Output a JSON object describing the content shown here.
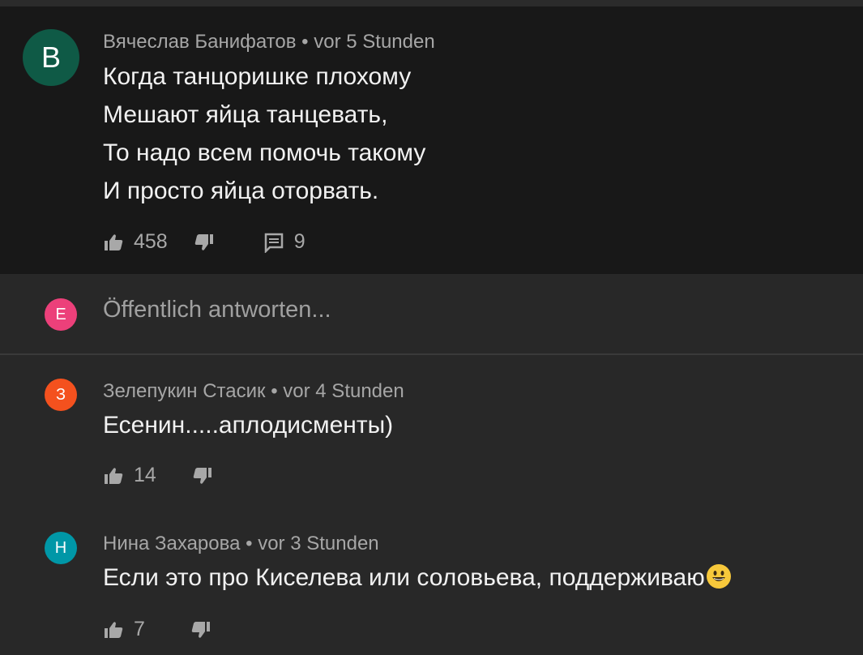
{
  "comments": [
    {
      "avatar_letter": "B",
      "avatar_color": "#0f5a46",
      "author": "Вячеслав Банифатов",
      "time": "vor 5 Stunden",
      "lines": [
        "Когда танцоришке плохому",
        "Мешают яйца танцевать,",
        "То надо всем помочь такому",
        "И просто яйца оторвать."
      ],
      "likes": "458",
      "replies": "9"
    },
    {
      "avatar_letter": "З",
      "avatar_color": "#f4511e",
      "author": "Зелепукин Стасик",
      "time": "vor 4 Stunden",
      "lines": [
        "Есенин.....аплодисменты)"
      ],
      "likes": "14"
    },
    {
      "avatar_letter": "Н",
      "avatar_color": "#0097a7",
      "author": "Нина Захарова",
      "time": "vor 3 Stunden",
      "lines": [
        "Если  это про Киселева или соловьева, поддерживаю"
      ],
      "likes": "7",
      "emoji": "grinning-face-emoji"
    }
  ],
  "reply_box": {
    "avatar_letter": "E",
    "avatar_color": "#ec407a",
    "placeholder": "Öffentlich antworten..."
  },
  "separator": " • "
}
